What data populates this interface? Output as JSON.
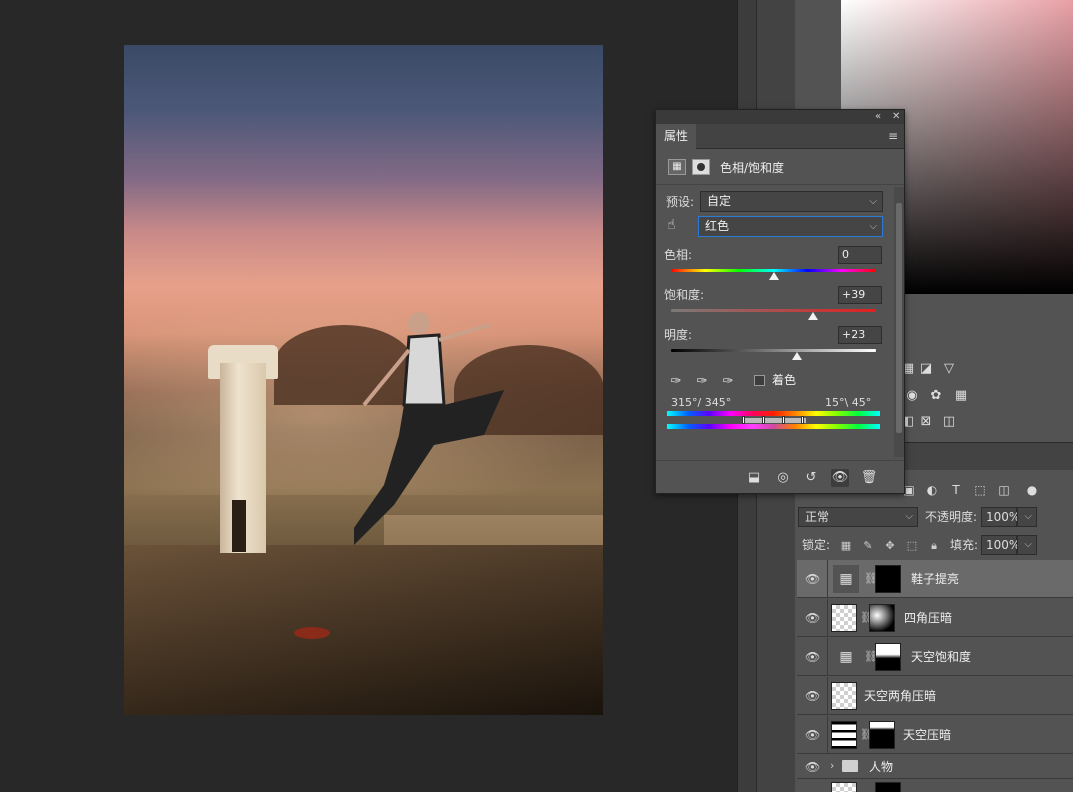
{
  "properties_panel": {
    "tab_label": "属性",
    "adjustment_title": "色相/饱和度",
    "preset_label": "预设:",
    "preset_value": "自定",
    "channel_value": "红色",
    "hue_label": "色相:",
    "hue_value": "0",
    "saturation_label": "饱和度:",
    "saturation_value": "+39",
    "lightness_label": "明度:",
    "lightness_value": "+23",
    "colorize_label": "着色",
    "colorize_checked": false,
    "range_left": "315°/ 345°",
    "range_right": "15°\\ 45°",
    "hue_fraction": 0.5,
    "saturation_fraction": 0.695,
    "lightness_fraction": 0.615
  },
  "layers_panel": {
    "blend_mode": "正常",
    "opacity_label": "不透明度:",
    "opacity_value": "100%",
    "lock_label": "锁定:",
    "fill_label": "填充:",
    "fill_value": "100%",
    "layers": [
      {
        "name": "鞋子提亮",
        "selected": true
      },
      {
        "name": "四角压暗",
        "selected": false
      },
      {
        "name": "天空饱和度",
        "selected": false
      },
      {
        "name": "天空两角压暗",
        "selected": false
      },
      {
        "name": "天空压暗",
        "selected": false
      }
    ],
    "group_name": "人物"
  },
  "icons": {
    "eye": "eye-icon",
    "chain": "link-icon",
    "folder": "folder-icon",
    "trash": "trash-icon"
  }
}
